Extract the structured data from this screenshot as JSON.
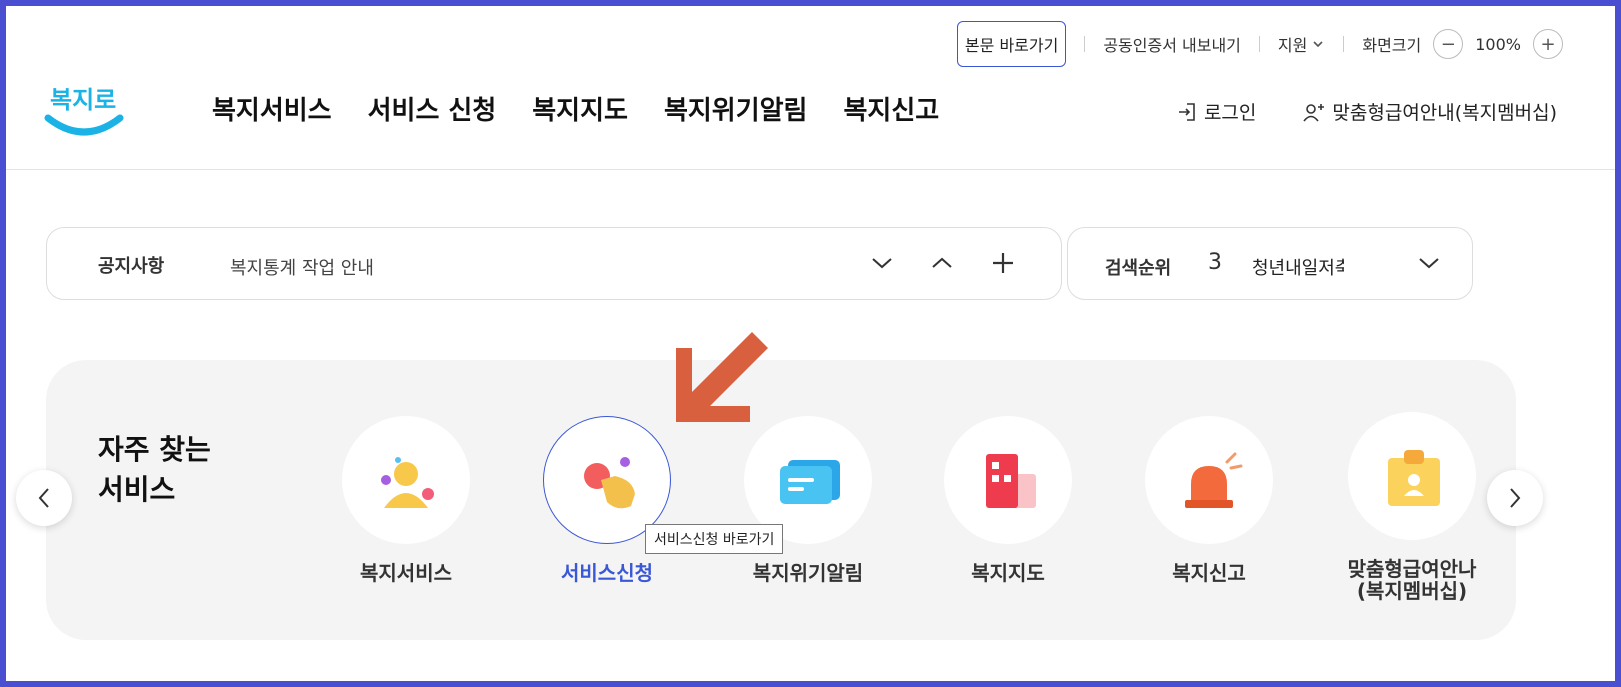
{
  "utility": {
    "skip_link": "본문 바로가기",
    "cert_export": "공동인증서 내보내기",
    "support": "지원",
    "screen_size": "화면크기",
    "zoom_out": "−",
    "zoom_value": "100%",
    "zoom_in": "+"
  },
  "logo": {
    "text": "복지로"
  },
  "gnb": [
    "복지서비스",
    "서비스 신청",
    "복지지도",
    "복지위기알림",
    "복지신고"
  ],
  "right_nav": {
    "login": "로그인",
    "membership": "맞춤형급여안내(복지멤버십)"
  },
  "notice": {
    "label": "공지사항",
    "text": "복지통계 작업 안내"
  },
  "rank": {
    "label": "검색순위",
    "number": "3",
    "keyword": "청년내일저축"
  },
  "frequent": {
    "title_line1": "자주 찾는",
    "title_line2": "서비스",
    "items": [
      {
        "label": "복지서비스",
        "icon": "people-icon"
      },
      {
        "label": "서비스신청",
        "icon": "hand-tap-icon"
      },
      {
        "label": "복지위기알림",
        "icon": "message-icon"
      },
      {
        "label": "복지지도",
        "icon": "map-building-icon"
      },
      {
        "label": "복지신고",
        "icon": "siren-icon"
      },
      {
        "label_line1": "맞춤형급여안나",
        "label_line2": "(복지멤버십)",
        "icon": "id-card-icon"
      }
    ],
    "tooltip": "서비스신청 바로가기"
  },
  "colors": {
    "accent": "#3a57d6",
    "arrow": "#d9603f",
    "frame": "#4a4fd1",
    "logo": "#1bb3e6"
  }
}
